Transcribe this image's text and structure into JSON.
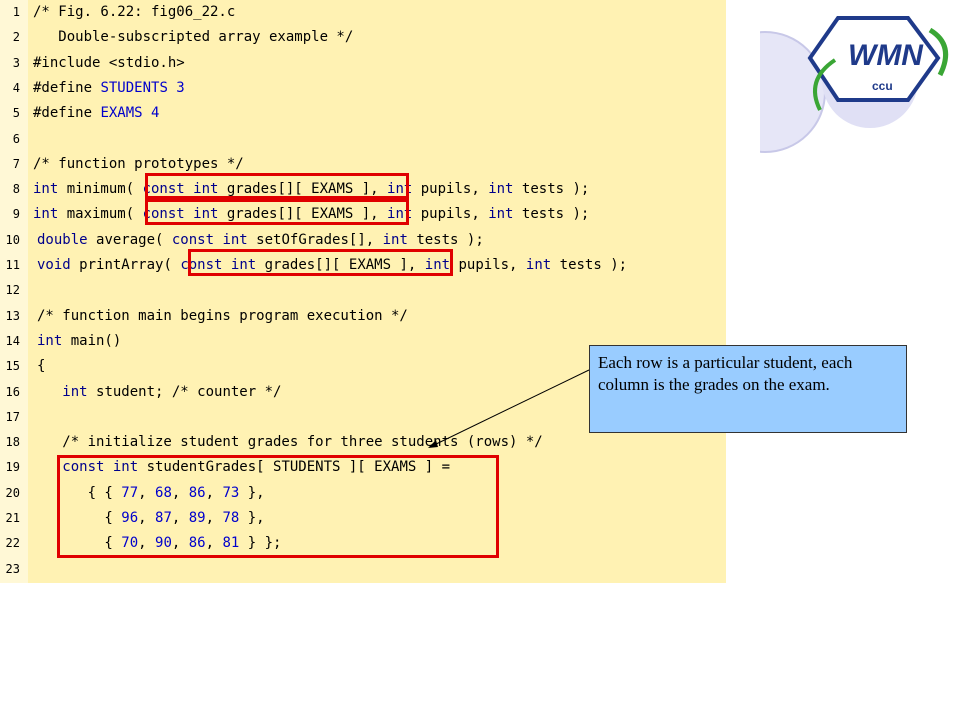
{
  "code_lines": [
    {
      "num": "1",
      "parts": [
        {
          "t": "/* Fig. 6.22: fig06_22.c",
          "c": "c"
        }
      ]
    },
    {
      "num": "2",
      "parts": [
        {
          "t": "   Double-subscripted array example */",
          "c": "c"
        }
      ]
    },
    {
      "num": "3",
      "parts": [
        {
          "t": "#include <stdio.h>",
          "c": "c"
        }
      ]
    },
    {
      "num": "4",
      "parts": [
        {
          "t": "#define ",
          "c": "c"
        },
        {
          "t": "STUDENTS 3",
          "c": "n"
        }
      ]
    },
    {
      "num": "5",
      "parts": [
        {
          "t": "#define ",
          "c": "c"
        },
        {
          "t": "EXAMS 4",
          "c": "n"
        }
      ]
    },
    {
      "num": "6",
      "parts": []
    },
    {
      "num": "7",
      "parts": [
        {
          "t": "/* function prototypes */",
          "c": "c"
        }
      ]
    },
    {
      "num": "8",
      "parts": [
        {
          "t": "int ",
          "c": "k"
        },
        {
          "t": "minimum( ",
          "c": "c"
        },
        {
          "t": "const int ",
          "c": "k"
        },
        {
          "t": "grades[][ EXAMS ], ",
          "c": "c"
        },
        {
          "t": "int ",
          "c": "k"
        },
        {
          "t": "pupils, ",
          "c": "c"
        },
        {
          "t": "int ",
          "c": "k"
        },
        {
          "t": "tests );",
          "c": "c"
        }
      ]
    },
    {
      "num": "9",
      "parts": [
        {
          "t": "int ",
          "c": "k"
        },
        {
          "t": "maximum( ",
          "c": "c"
        },
        {
          "t": "const int ",
          "c": "k"
        },
        {
          "t": "grades[][ EXAMS ], ",
          "c": "c"
        },
        {
          "t": "int ",
          "c": "k"
        },
        {
          "t": "pupils, ",
          "c": "c"
        },
        {
          "t": "int ",
          "c": "k"
        },
        {
          "t": "tests );",
          "c": "c"
        }
      ]
    },
    {
      "num": "10",
      "parts": [
        {
          "t": "double ",
          "c": "k"
        },
        {
          "t": "average( ",
          "c": "c"
        },
        {
          "t": "const int ",
          "c": "k"
        },
        {
          "t": "setOfGrades[], ",
          "c": "c"
        },
        {
          "t": "int ",
          "c": "k"
        },
        {
          "t": "tests );",
          "c": "c"
        }
      ]
    },
    {
      "num": "11",
      "parts": [
        {
          "t": "void ",
          "c": "k"
        },
        {
          "t": "printArray( ",
          "c": "c"
        },
        {
          "t": "const int ",
          "c": "k"
        },
        {
          "t": "grades[][ EXAMS ], ",
          "c": "c"
        },
        {
          "t": "int ",
          "c": "k"
        },
        {
          "t": "pupils, ",
          "c": "c"
        },
        {
          "t": "int ",
          "c": "k"
        },
        {
          "t": "tests );",
          "c": "c"
        }
      ]
    },
    {
      "num": "12",
      "parts": []
    },
    {
      "num": "13",
      "parts": [
        {
          "t": "/* function main begins program execution */",
          "c": "c"
        }
      ]
    },
    {
      "num": "14",
      "parts": [
        {
          "t": "int ",
          "c": "k"
        },
        {
          "t": "main()",
          "c": "c"
        }
      ]
    },
    {
      "num": "15",
      "parts": [
        {
          "t": "{",
          "c": "c"
        }
      ]
    },
    {
      "num": "16",
      "parts": [
        {
          "t": "   int ",
          "c": "k"
        },
        {
          "t": "student; /* counter */",
          "c": "c"
        }
      ]
    },
    {
      "num": "17",
      "parts": []
    },
    {
      "num": "18",
      "parts": [
        {
          "t": "   /* initialize student grades for three students (rows) */",
          "c": "c"
        }
      ]
    },
    {
      "num": "19",
      "parts": [
        {
          "t": "   const int ",
          "c": "k"
        },
        {
          "t": "studentGrades[ STUDENTS ][ EXAMS ] =",
          "c": "c"
        }
      ]
    },
    {
      "num": "20",
      "parts": [
        {
          "t": "      { { ",
          "c": "c"
        },
        {
          "t": "77",
          "c": "n"
        },
        {
          "t": ", ",
          "c": "c"
        },
        {
          "t": "68",
          "c": "n"
        },
        {
          "t": ", ",
          "c": "c"
        },
        {
          "t": "86",
          "c": "n"
        },
        {
          "t": ", ",
          "c": "c"
        },
        {
          "t": "73",
          "c": "n"
        },
        {
          "t": " },",
          "c": "c"
        }
      ]
    },
    {
      "num": "21",
      "parts": [
        {
          "t": "        { ",
          "c": "c"
        },
        {
          "t": "96",
          "c": "n"
        },
        {
          "t": ", ",
          "c": "c"
        },
        {
          "t": "87",
          "c": "n"
        },
        {
          "t": ", ",
          "c": "c"
        },
        {
          "t": "89",
          "c": "n"
        },
        {
          "t": ", ",
          "c": "c"
        },
        {
          "t": "78",
          "c": "n"
        },
        {
          "t": " },",
          "c": "c"
        }
      ]
    },
    {
      "num": "22",
      "parts": [
        {
          "t": "        { ",
          "c": "c"
        },
        {
          "t": "70",
          "c": "n"
        },
        {
          "t": ", ",
          "c": "c"
        },
        {
          "t": "90",
          "c": "n"
        },
        {
          "t": ", ",
          "c": "c"
        },
        {
          "t": "86",
          "c": "n"
        },
        {
          "t": ", ",
          "c": "c"
        },
        {
          "t": "81",
          "c": "n"
        },
        {
          "t": " } };",
          "c": "c"
        }
      ]
    },
    {
      "num": "23",
      "parts": []
    }
  ],
  "callout": {
    "text": "Each row is a particular student, each column is the grades on the exam."
  },
  "logo": {
    "main_text": "WMN",
    "sub_text": "ccu"
  },
  "colors": {
    "code_background": "#fff2b3",
    "highlight_box": "#e00000",
    "callout_background": "#99ccff",
    "keyword": "#00008b",
    "number": "#0000cc"
  }
}
